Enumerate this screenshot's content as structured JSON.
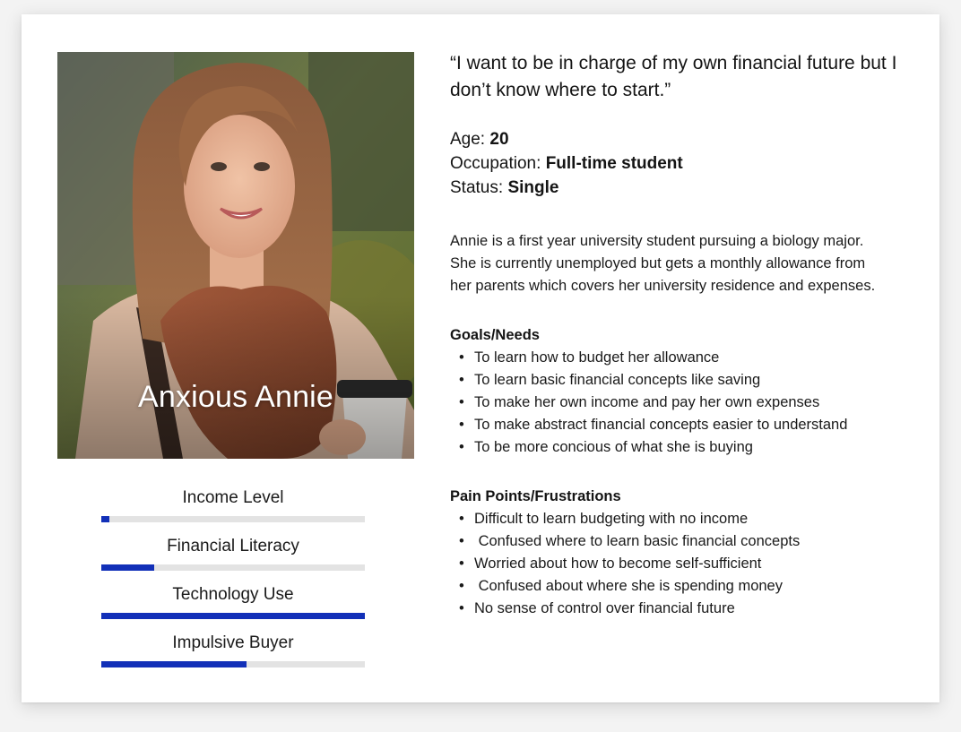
{
  "persona": {
    "name": "Anxious Annie",
    "quote": "“I want to be in charge of my own financial future but I don’t know where to start.”",
    "stats": [
      {
        "label": "Age:",
        "value": "20"
      },
      {
        "label": "Occupation:",
        "value": "Full-time student"
      },
      {
        "label": "Status:",
        "value": "Single"
      }
    ],
    "bio": "Annie is a first year university student pursuing a biology major. She is currently unemployed but gets a monthly allowance from her parents which covers her university residence and expenses."
  },
  "meters": [
    {
      "label": "Income Level",
      "level": 0.03
    },
    {
      "label": "Financial Literacy",
      "level": 0.2
    },
    {
      "label": "Technology Use",
      "level": 1.0
    },
    {
      "label": "Impulsive Buyer",
      "level": 0.55
    }
  ],
  "goals": {
    "title": "Goals/Needs",
    "items": [
      "To learn how to budget her allowance",
      "To learn basic financial concepts like saving",
      "To make her own income and pay her own expenses",
      "To make abstract financial concepts easier to understand",
      "To be more concious of what she is buying"
    ]
  },
  "pains": {
    "title": "Pain Points/Frustrations",
    "items": [
      "Difficult to learn budgeting with no income",
      " Confused where to learn basic financial concepts",
      "Worried about how to become self-sufficient",
      " Confused about where she is spending money",
      "No sense of control over financial future"
    ]
  },
  "colors": {
    "accent": "#1230b8",
    "track": "#e3e3e3"
  }
}
